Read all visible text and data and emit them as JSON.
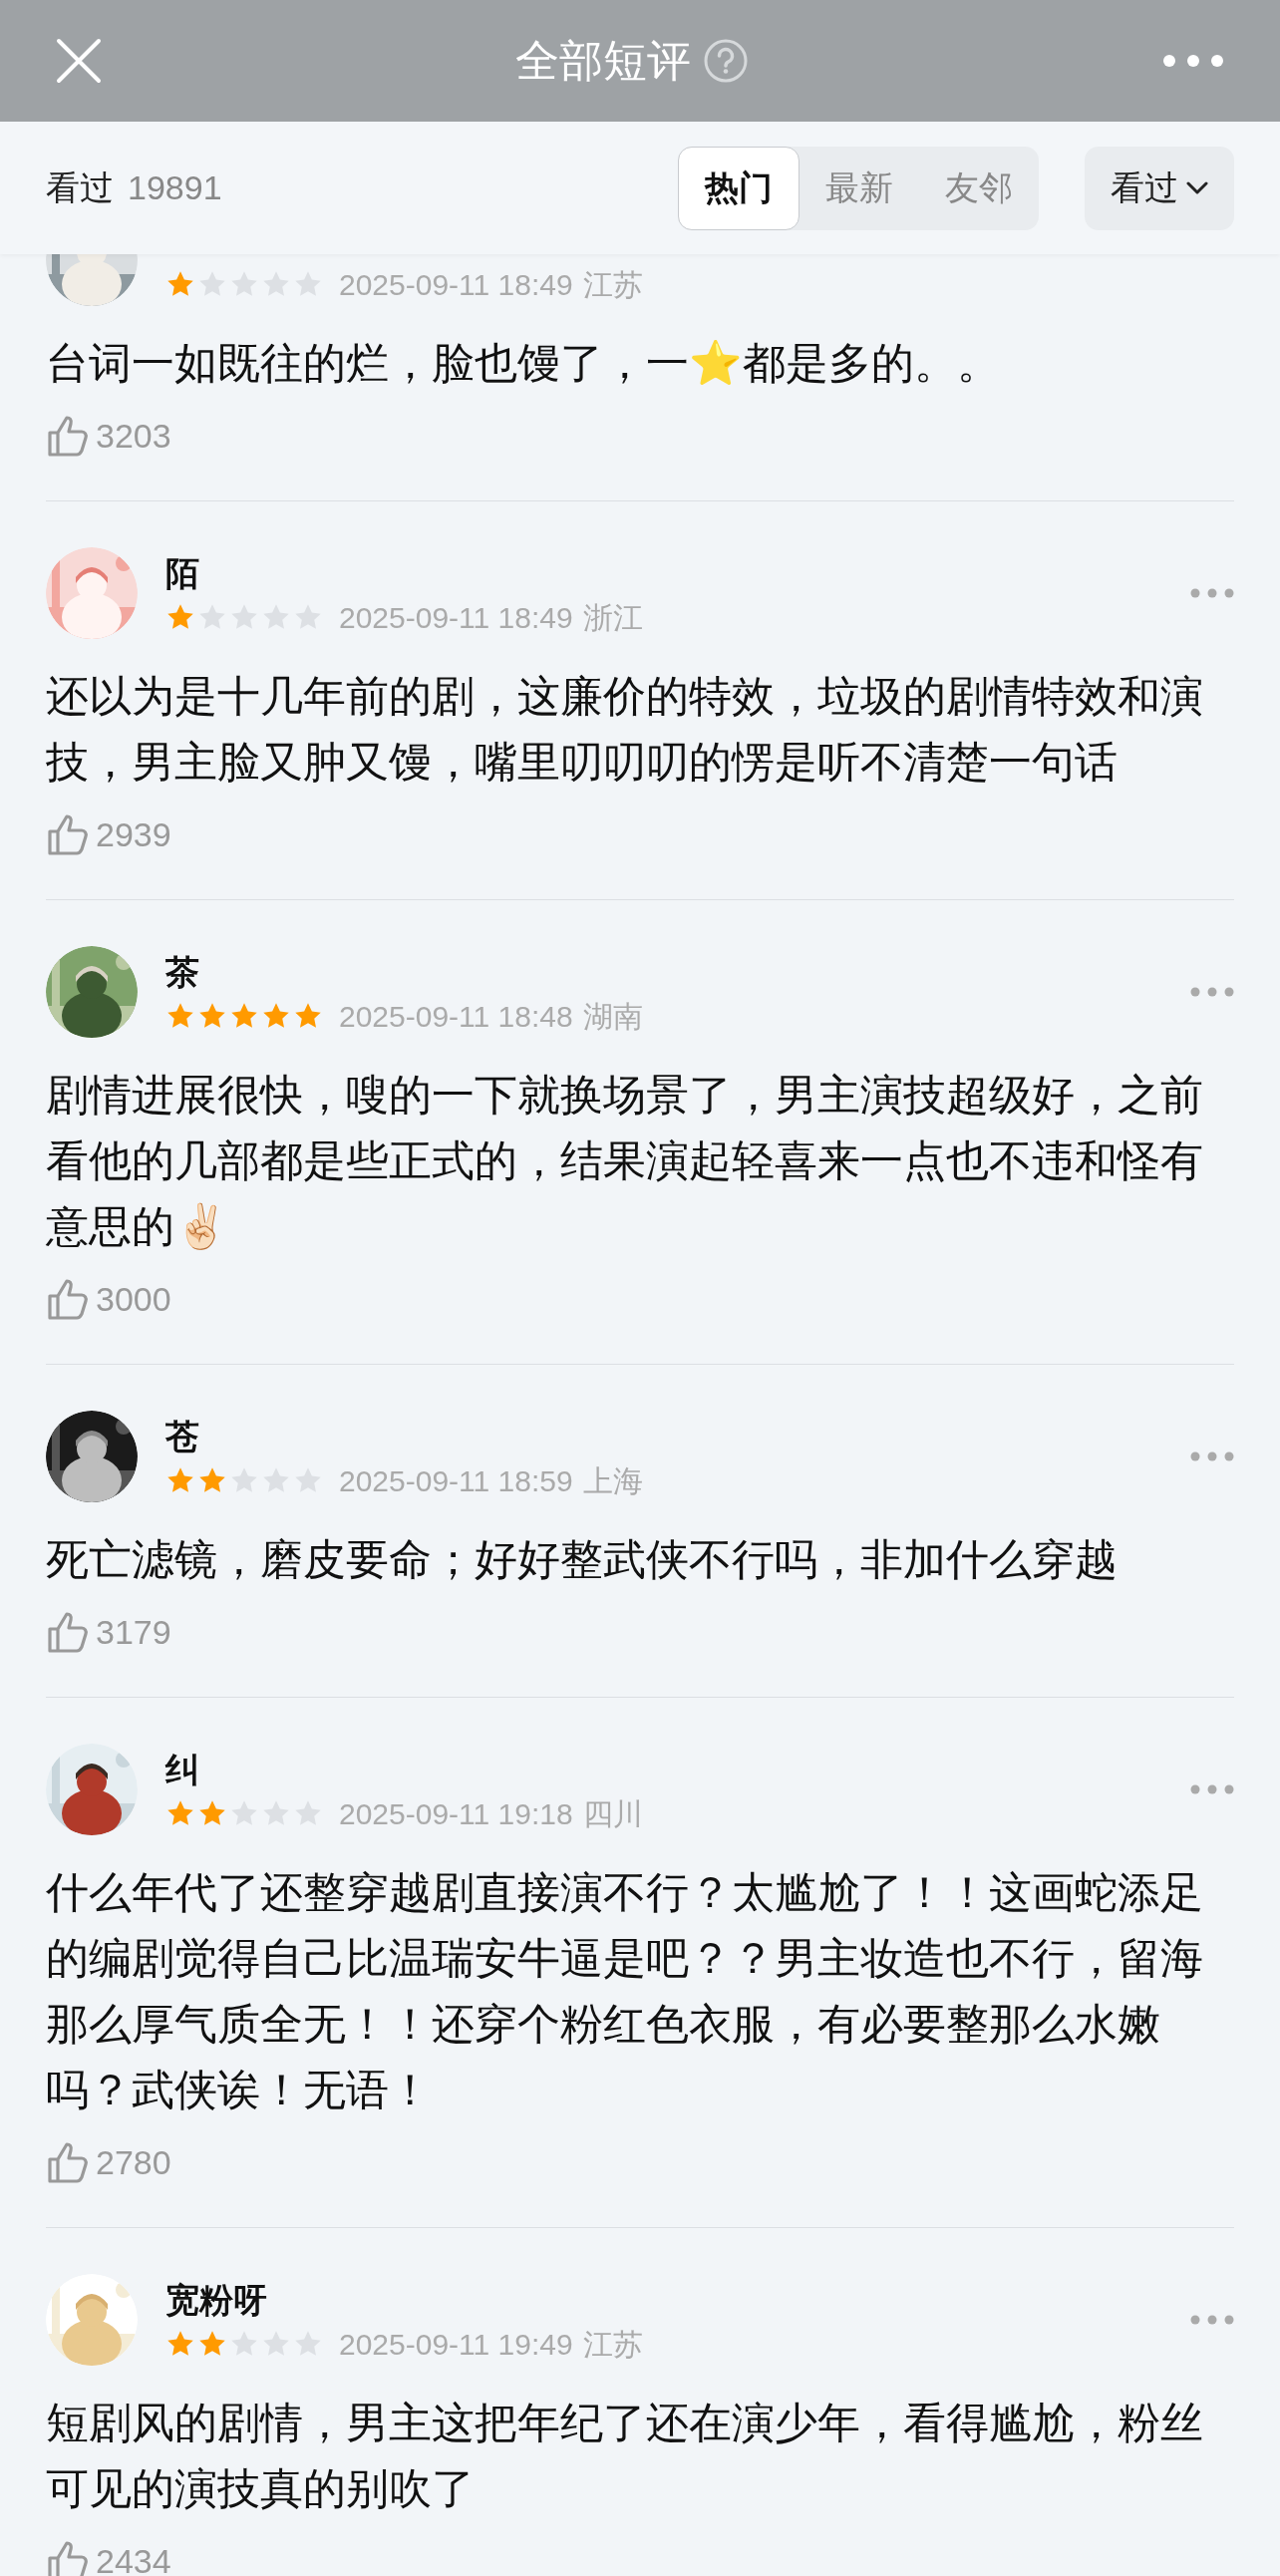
{
  "header": {
    "title": "全部短评"
  },
  "filter_bar": {
    "label": "看过",
    "count": "19891",
    "tabs": [
      {
        "label": "热门",
        "selected": true
      },
      {
        "label": "最新",
        "selected": false
      },
      {
        "label": "友邻",
        "selected": false
      }
    ],
    "dropdown": "看过"
  },
  "reviews": [
    {
      "stars": 1,
      "time": "2025-09-11 18:49",
      "location": "江苏",
      "text": "台词一如既往的烂，脸也馒了，一⭐都是多的。。",
      "likes": "3203"
    },
    {
      "name": "陌",
      "stars": 1,
      "time": "2025-09-11 18:49",
      "location": "浙江",
      "text": "还以为是十几年前的剧，这廉价的特效，垃圾的剧情特效和演技，男主脸又肿又馒，嘴里叨叨叨的愣是听不清楚一句话",
      "likes": "2939"
    },
    {
      "name": "茶",
      "stars": 5,
      "time": "2025-09-11 18:48",
      "location": "湖南",
      "text": "剧情进展很快，嗖的一下就换场景了，男主演技超级好，之前看他的几部都是些正式的，结果演起轻喜来一点也不违和怪有意思的✌🏻",
      "likes": "3000"
    },
    {
      "name": "苍",
      "stars": 2,
      "time": "2025-09-11 18:59",
      "location": "上海",
      "text": "死亡滤镜，磨皮要命；好好整武侠不行吗，非加什么穿越",
      "likes": "3179"
    },
    {
      "name": "纠",
      "stars": 2,
      "time": "2025-09-11 19:18",
      "location": "四川",
      "text": "什么年代了还整穿越剧直接演不行？太尴尬了！！这画蛇添足的编剧觉得自己比温瑞安牛逼是吧？？男主妆造也不行，留海那么厚气质全无！！还穿个粉红色衣服，有必要整那么水嫩吗？武侠诶！无语！",
      "likes": "2780"
    },
    {
      "name": "宽粉呀",
      "stars": 2,
      "time": "2025-09-11 19:49",
      "location": "江苏",
      "text": "短剧风的剧情，男主这把年纪了还在演少年，看得尴尬，粉丝可见的演技真的别吹了",
      "likes": "2434"
    }
  ]
}
